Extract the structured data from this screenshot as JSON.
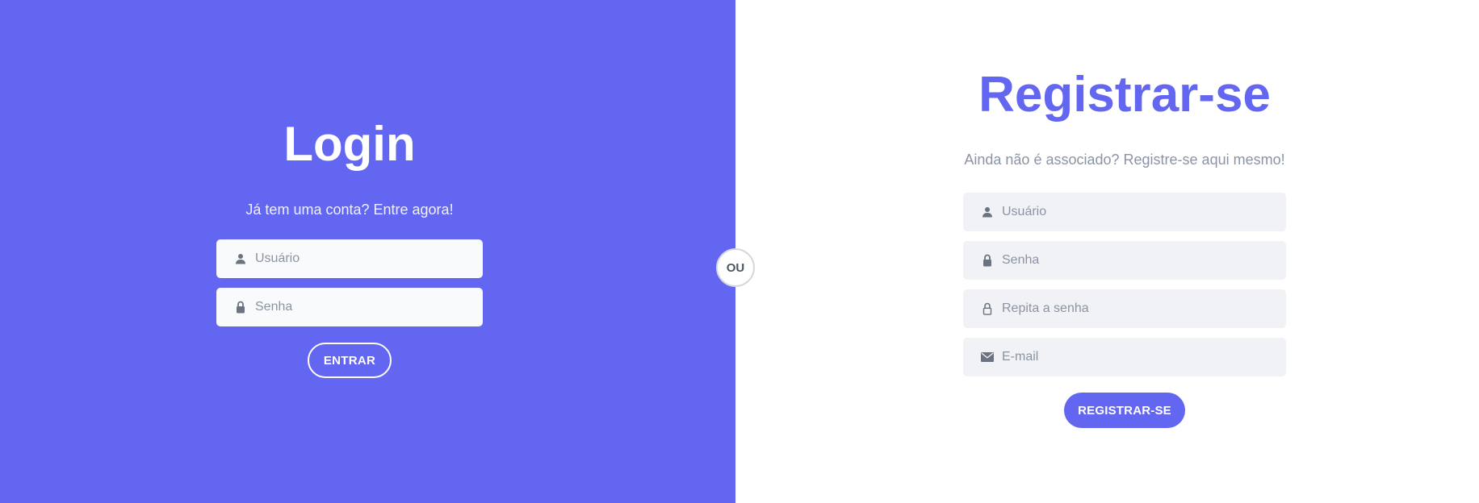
{
  "colors": {
    "accent": "#6366f1",
    "left_panel_bg": "#6366f1",
    "right_panel_bg": "#ffffff",
    "field_bg_left": "#f8fafc",
    "field_bg_right": "#f1f2f5",
    "placeholder": "#8b94a3",
    "icon": "#6b7280"
  },
  "login": {
    "title": "Login",
    "subtitle": "Já tem uma conta? Entre agora!",
    "fields": [
      {
        "icon": "user-icon",
        "placeholder": "Usuário",
        "value": ""
      },
      {
        "icon": "lock-icon",
        "placeholder": "Senha",
        "value": ""
      }
    ],
    "button_label": "ENTRAR"
  },
  "divider": {
    "label": "OU"
  },
  "register": {
    "title": "Registrar-se",
    "subtitle": "Ainda não é associado? Registre-se aqui mesmo!",
    "fields": [
      {
        "icon": "user-icon",
        "placeholder": "Usuário",
        "value": ""
      },
      {
        "icon": "lock-icon",
        "placeholder": "Senha",
        "value": ""
      },
      {
        "icon": "lock-outline-icon",
        "placeholder": "Repita a senha",
        "value": ""
      },
      {
        "icon": "envelope-icon",
        "placeholder": "E-mail",
        "value": ""
      }
    ],
    "button_label": "REGISTRAR-SE"
  }
}
